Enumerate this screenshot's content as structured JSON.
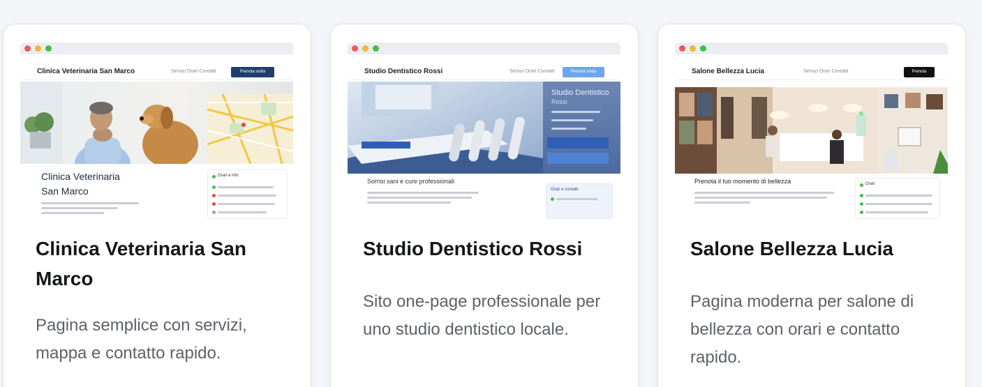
{
  "cards": [
    {
      "title": "Clinica Veterinaria San Marco",
      "description": "Pagina semplice con servizi, mappa e contatto rapido.",
      "preview": {
        "logo": "Clinica Veterinaria San Marco",
        "nav_links": "Servizi Orari Contatti",
        "cta": "Prenota visita",
        "heading_line1": "Clinica Veterinaria",
        "heading_line2": "San Marco",
        "side_title": "Orari e info",
        "accent": "#1f3e6e"
      }
    },
    {
      "title": "Studio Dentistico Rossi",
      "description": "Sito one-page professionale per uno studio dentistico locale.",
      "preview": {
        "logo": "Studio Dentistico Rossi",
        "nav_links": "Servizi Orari Contatti",
        "cta": "Prenota visita",
        "hero_text": "Studio Dentistico",
        "hero_sub": "Rossi",
        "heading": "Sorrisi sani e cure professionali",
        "side_title": "Orari e contatti",
        "accent": "#4a8fe0"
      }
    },
    {
      "title": "Salone Bellezza Lucia",
      "description": "Pagina moderna per salone di bellezza con orari e contatto rapido.",
      "preview": {
        "logo": "Salone Bellezza Lucia",
        "nav_links": "Servizi Orari Contatti",
        "cta": "Prenota",
        "heading": "Prenota il tuo momento di bellezza",
        "side_title": "Orari",
        "accent": "#111111"
      }
    }
  ]
}
